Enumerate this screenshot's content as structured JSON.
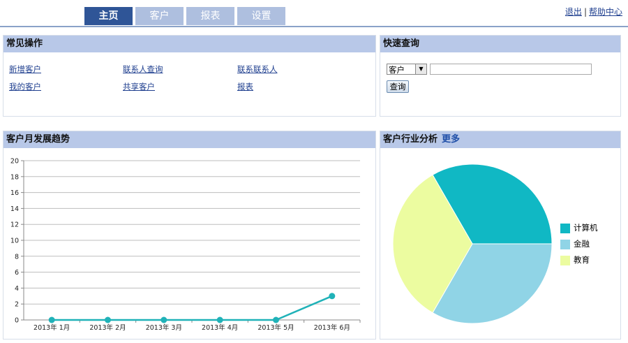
{
  "nav": {
    "tabs": [
      {
        "label": "主页",
        "active": true
      },
      {
        "label": "客户",
        "active": false
      },
      {
        "label": "报表",
        "active": false
      },
      {
        "label": "设置",
        "active": false
      }
    ],
    "logout": "退出",
    "separator": "|",
    "help": "帮助中心"
  },
  "ops_panel": {
    "title": "常见操作",
    "links": [
      "新增客户",
      "联系人查询",
      "联系联系人",
      "我的客户",
      "共享客户",
      "报表"
    ]
  },
  "quick_search": {
    "title": "快速查询",
    "select_value": "客户",
    "input_value": "",
    "button_label": "查询"
  },
  "trend_panel": {
    "title": "客户月发展趋势"
  },
  "industry_panel": {
    "title": "客户行业分析",
    "more_link": "更多"
  },
  "colors": {
    "line": "#20b2b8",
    "tab_active": "#2f5597",
    "tab_inactive": "#aebfdf",
    "panel_head": "#b8c8e8"
  },
  "chart_data": [
    {
      "type": "line",
      "title": "",
      "categories": [
        "2013年 1月",
        "2013年 2月",
        "2013年 3月",
        "2013年 4月",
        "2013年 5月",
        "2013年 6月"
      ],
      "series": [
        {
          "values": [
            0,
            0,
            0,
            0,
            0,
            3
          ]
        }
      ],
      "ylim": [
        0,
        20
      ],
      "yticks": [
        0,
        2,
        4,
        6,
        8,
        10,
        12,
        14,
        16,
        18,
        20
      ],
      "grid": true,
      "color": "#20b2b8"
    },
    {
      "type": "pie",
      "title": "",
      "labels": [
        "计算机",
        "金融",
        "教育"
      ],
      "values": [
        1,
        1,
        1
      ],
      "colors": [
        "#10b8c4",
        "#90d4e6",
        "#ecfca0"
      ],
      "legend": "right"
    }
  ]
}
